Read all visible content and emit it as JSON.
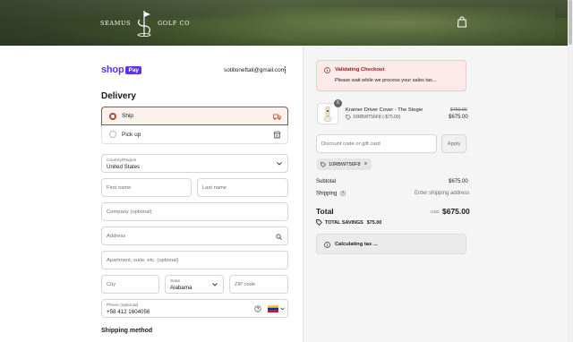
{
  "header": {
    "brand_left": "SEAMUS",
    "brand_right": "GOLF CO",
    "cart_icon": "shopping-bag-icon"
  },
  "account": {
    "shop_pay_word": "shop",
    "shop_pay_badge": "Pay",
    "email": "sotilloneftali@gmail.com"
  },
  "delivery": {
    "title": "Delivery",
    "options": [
      {
        "label": "Ship",
        "selected": true,
        "icon": "truck-icon"
      },
      {
        "label": "Pick up",
        "selected": false,
        "icon": "store-icon"
      }
    ],
    "country": {
      "label": "Country/Region",
      "value": "United States"
    },
    "first_name": {
      "placeholder": "First name"
    },
    "last_name": {
      "placeholder": "Last name"
    },
    "company": {
      "placeholder": "Company (optional)"
    },
    "address": {
      "placeholder": "Address"
    },
    "apartment": {
      "placeholder": "Apartment, suite, etc. (optional)"
    },
    "city": {
      "placeholder": "City"
    },
    "state": {
      "label": "State",
      "value": "Alabama"
    },
    "zip": {
      "placeholder": "ZIP code"
    },
    "phone": {
      "label": "Phone (optional)",
      "value": "+58 412 1604056"
    },
    "shipping_method_title": "Shipping method"
  },
  "summary": {
    "alert": {
      "title": "Validating Checkout",
      "text": "Please wait while we process your sales tax..."
    },
    "product": {
      "quantity": "6",
      "name": "Kramer Driver Cover - The Stogie",
      "discount": "10RBWT56F8 (-$75.00)",
      "price_old": "$750.00",
      "price_new": "$675.00"
    },
    "discount_input": {
      "placeholder": "Discount code or gift card"
    },
    "apply_label": "Apply",
    "applied_code": "10RBWT56F8",
    "subtotal_label": "Subtotal",
    "subtotal_value": "$675.00",
    "shipping_label": "Shipping",
    "shipping_value": "Enter shipping address",
    "total_label": "Total",
    "total_currency": "USD",
    "total_value": "$675.00",
    "savings_label": "TOTAL SAVINGS",
    "savings_value": "$75.00",
    "calculating_text": "Calculating tax ..."
  },
  "colors": {
    "accent": "#a84b2e",
    "shop_pay": "#5a31f4",
    "alert_bg": "#fcebea",
    "alert_title": "#8b1d14"
  }
}
